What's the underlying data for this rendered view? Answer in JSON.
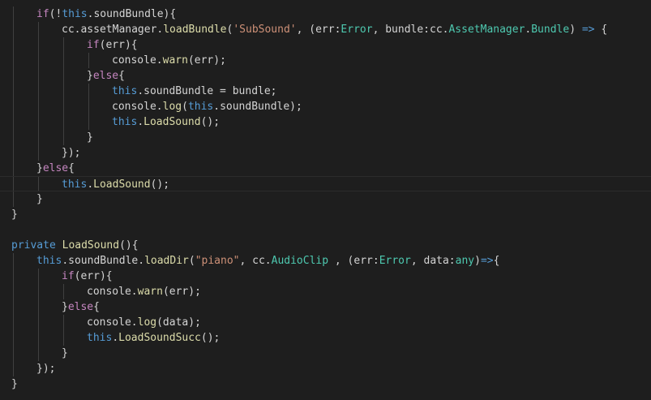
{
  "editor": {
    "colors": {
      "background": "#1e1e1e",
      "keyword": "#c586c0",
      "this": "#569cd6",
      "string": "#ce9178",
      "type": "#4ec9b0",
      "function": "#dcdcaa",
      "text": "#d4d4d4"
    },
    "lines": [
      {
        "indent": 1,
        "tokens": [
          [
            "keyword",
            "if"
          ],
          [
            "plain",
            "(!"
          ],
          [
            "this",
            "this"
          ],
          [
            "plain",
            ".soundBundle){"
          ]
        ]
      },
      {
        "indent": 2,
        "tokens": [
          [
            "plain",
            "cc.assetManager."
          ],
          [
            "func",
            "loadBundle"
          ],
          [
            "plain",
            "("
          ],
          [
            "string",
            "'SubSound'"
          ],
          [
            "plain",
            ", (err:"
          ],
          [
            "type",
            "Error"
          ],
          [
            "plain",
            ", bundle:cc."
          ],
          [
            "type",
            "AssetManager"
          ],
          [
            "plain",
            "."
          ],
          [
            "type",
            "Bundle"
          ],
          [
            "plain",
            ") "
          ],
          [
            "this",
            "=>"
          ],
          [
            "plain",
            " {"
          ]
        ]
      },
      {
        "indent": 3,
        "tokens": [
          [
            "keyword",
            "if"
          ],
          [
            "plain",
            "(err){"
          ]
        ]
      },
      {
        "indent": 4,
        "tokens": [
          [
            "plain",
            "console."
          ],
          [
            "func",
            "warn"
          ],
          [
            "plain",
            "(err);"
          ]
        ]
      },
      {
        "indent": 3,
        "tokens": [
          [
            "plain",
            "}"
          ],
          [
            "keyword",
            "else"
          ],
          [
            "plain",
            "{"
          ]
        ]
      },
      {
        "indent": 4,
        "tokens": [
          [
            "this",
            "this"
          ],
          [
            "plain",
            ".soundBundle = bundle;"
          ]
        ]
      },
      {
        "indent": 4,
        "tokens": [
          [
            "plain",
            "console."
          ],
          [
            "func",
            "log"
          ],
          [
            "plain",
            "("
          ],
          [
            "this",
            "this"
          ],
          [
            "plain",
            ".soundBundle);"
          ]
        ]
      },
      {
        "indent": 4,
        "tokens": [
          [
            "this",
            "this"
          ],
          [
            "plain",
            "."
          ],
          [
            "func",
            "LoadSound"
          ],
          [
            "plain",
            "();"
          ]
        ]
      },
      {
        "indent": 3,
        "tokens": [
          [
            "plain",
            "}"
          ]
        ]
      },
      {
        "indent": 2,
        "tokens": [
          [
            "plain",
            "});"
          ]
        ]
      },
      {
        "indent": 1,
        "tokens": [
          [
            "plain",
            "}"
          ],
          [
            "keyword",
            "else"
          ],
          [
            "plain",
            "{"
          ]
        ]
      },
      {
        "indent": 2,
        "current": true,
        "tokens": [
          [
            "this",
            "this"
          ],
          [
            "plain",
            "."
          ],
          [
            "func",
            "LoadSound"
          ],
          [
            "plain",
            "();"
          ]
        ]
      },
      {
        "indent": 1,
        "tokens": [
          [
            "plain",
            "}"
          ]
        ]
      },
      {
        "indent": 0,
        "tokens": [
          [
            "plain",
            "}"
          ]
        ]
      },
      {
        "indent": 0,
        "tokens": []
      },
      {
        "indent": 0,
        "tokens": [
          [
            "this",
            "private"
          ],
          [
            "plain",
            " "
          ],
          [
            "func",
            "LoadSound"
          ],
          [
            "plain",
            "(){"
          ]
        ]
      },
      {
        "indent": 1,
        "tokens": [
          [
            "this",
            "this"
          ],
          [
            "plain",
            ".soundBundle."
          ],
          [
            "func",
            "loadDir"
          ],
          [
            "plain",
            "("
          ],
          [
            "string",
            "\"piano\""
          ],
          [
            "plain",
            ", cc."
          ],
          [
            "type",
            "AudioClip"
          ],
          [
            "plain",
            " , (err:"
          ],
          [
            "type",
            "Error"
          ],
          [
            "plain",
            ", data:"
          ],
          [
            "type",
            "any"
          ],
          [
            "plain",
            ")"
          ],
          [
            "this",
            "=>"
          ],
          [
            "plain",
            "{"
          ]
        ]
      },
      {
        "indent": 2,
        "tokens": [
          [
            "keyword",
            "if"
          ],
          [
            "plain",
            "(err){"
          ]
        ]
      },
      {
        "indent": 3,
        "tokens": [
          [
            "plain",
            "console."
          ],
          [
            "func",
            "warn"
          ],
          [
            "plain",
            "(err);"
          ]
        ]
      },
      {
        "indent": 2,
        "tokens": [
          [
            "plain",
            "}"
          ],
          [
            "keyword",
            "else"
          ],
          [
            "plain",
            "{"
          ]
        ]
      },
      {
        "indent": 3,
        "tokens": [
          [
            "plain",
            "console."
          ],
          [
            "func",
            "log"
          ],
          [
            "plain",
            "(data);"
          ]
        ]
      },
      {
        "indent": 3,
        "tokens": [
          [
            "this",
            "this"
          ],
          [
            "plain",
            "."
          ],
          [
            "func",
            "LoadSoundSucc"
          ],
          [
            "plain",
            "();"
          ]
        ]
      },
      {
        "indent": 2,
        "tokens": [
          [
            "plain",
            "}"
          ]
        ]
      },
      {
        "indent": 1,
        "tokens": [
          [
            "plain",
            "});"
          ]
        ]
      },
      {
        "indent": 0,
        "tokens": [
          [
            "plain",
            "}"
          ]
        ]
      }
    ]
  }
}
